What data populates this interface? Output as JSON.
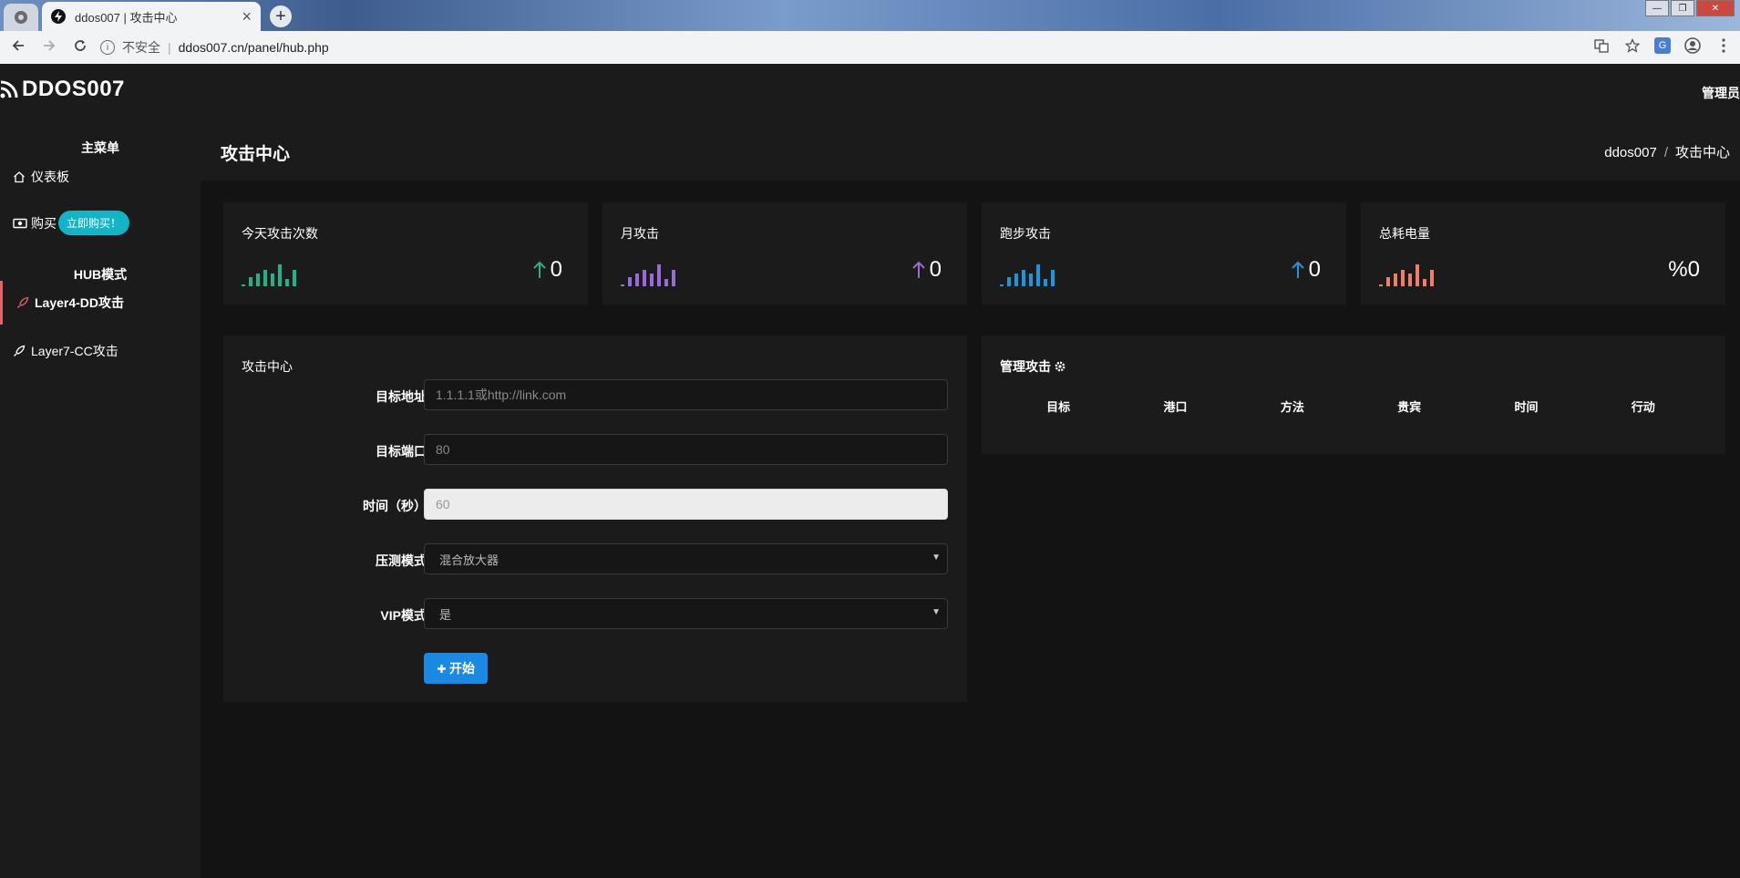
{
  "browser": {
    "tab_title": "ddos007 | 攻击中心",
    "tab_close": "×",
    "new_tab": "+",
    "insecure_label": "不安全",
    "separator": "|",
    "url": "ddos007.cn/panel/hub.php",
    "window_controls": [
      "—",
      "❐",
      "✕"
    ]
  },
  "header": {
    "logo_text": "DDOS007",
    "admin_label": "管理员"
  },
  "sidebar": {
    "main_menu_heading": "主菜单",
    "dashboard_label": "仪表板",
    "buy_label": "购买",
    "buy_badge": "立即购买！",
    "hub_heading": "HUB模式",
    "layer4_label": "Layer4-DD攻击",
    "layer7_label": "Layer7-CC攻击",
    "active_color": "#e0656b"
  },
  "page": {
    "title": "攻击中心",
    "breadcrumb_home": "ddos007",
    "breadcrumb_sep": "/",
    "breadcrumb_current": "攻击中心"
  },
  "stats": [
    {
      "title": "今天攻击次数",
      "prefix": "",
      "value": "0",
      "color": "#1fb38a",
      "arrow": true
    },
    {
      "title": "月攻击",
      "prefix": "",
      "value": "0",
      "color": "#9a6ad8",
      "arrow": true
    },
    {
      "title": "跑步攻击",
      "prefix": "",
      "value": "0",
      "color": "#1b95e0",
      "arrow": true
    },
    {
      "title": "总耗电量",
      "prefix": "%",
      "value": "0",
      "color": "#f07c6a",
      "arrow": false
    }
  ],
  "form": {
    "card_title": "攻击中心",
    "target_label": "目标地址",
    "target_placeholder": "1.1.1.1或http://link.com",
    "port_label": "目标端口",
    "port_placeholder": "80",
    "time_label": "时间（秒）",
    "time_value": "60",
    "method_label": "压测模式",
    "method_value": "混合放大器",
    "vip_label": "VIP模式",
    "vip_value": "是",
    "start_label": "开始",
    "start_color": "#1a89e4"
  },
  "manage": {
    "title": "管理攻击",
    "columns": [
      "目标",
      "港口",
      "方法",
      "贵宾",
      "时间",
      "行动"
    ]
  }
}
